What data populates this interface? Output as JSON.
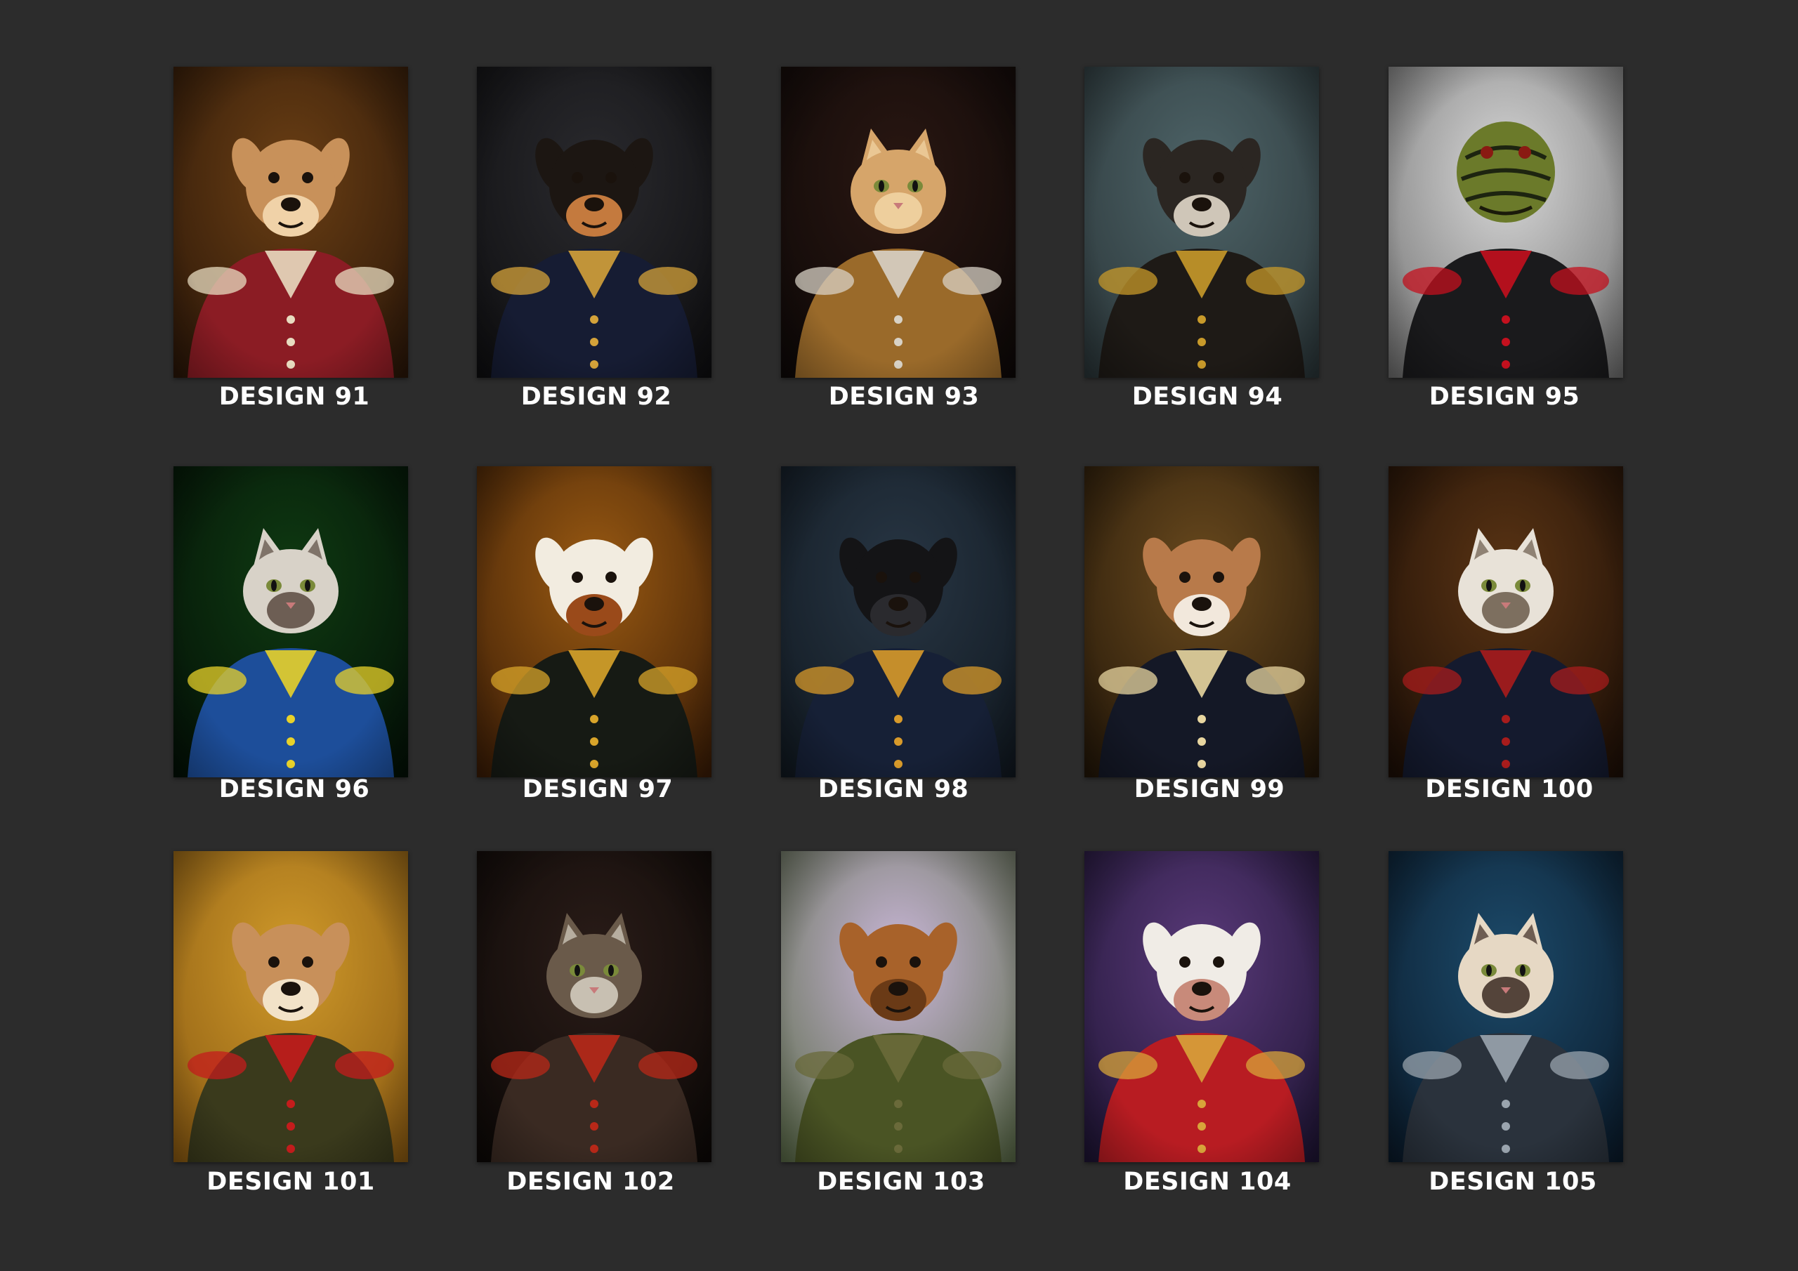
{
  "gallery": {
    "items": [
      {
        "label": "DESIGN 91",
        "subject": "bulldog-portrait",
        "bg": "#6b3f14",
        "bg2": "#2a1608",
        "fur": "#c8915a",
        "fur2": "#f0d2a8",
        "garment": "#8b1c24",
        "accent": "#e8dcc0",
        "icon": "dog-icon"
      },
      {
        "label": "DESIGN 92",
        "subject": "chihuahua-admiral",
        "bg": "#2a2a2e",
        "bg2": "#0e0e10",
        "fur": "#1c1612",
        "fur2": "#c47a3e",
        "garment": "#161c33",
        "accent": "#d4a23a",
        "icon": "dog-icon"
      },
      {
        "label": "DESIGN 93",
        "subject": "tabby-cat-ruff",
        "bg": "#2a1712",
        "bg2": "#0d0807",
        "fur": "#d6a56a",
        "fur2": "#f2d6a6",
        "garment": "#9a6a2a",
        "accent": "#d8d2c6",
        "icon": "cat-icon"
      },
      {
        "label": "DESIGN 94",
        "subject": "doodle-hussar",
        "bg": "#4e6468",
        "bg2": "#2a3538",
        "fur": "#2b2622",
        "fur2": "#cfc6b8",
        "garment": "#1e1a16",
        "accent": "#c89a2a",
        "icon": "dog-icon"
      },
      {
        "label": "DESIGN 95",
        "subject": "turtle-businessman",
        "bg": "#d8d8d8",
        "bg2": "#6f6f6f",
        "fur": "#6b7a2a",
        "fur2": "#1d2410",
        "garment": "#1a1a1c",
        "accent": "#c4101e",
        "icon": "turtle-icon"
      },
      {
        "label": "DESIGN 96",
        "subject": "cat-streetwear",
        "bg": "#0f3a12",
        "bg2": "#031006",
        "fur": "#d8d2c8",
        "fur2": "#5a4a40",
        "garment": "#1d4e9a",
        "accent": "#e8d22a",
        "icon": "cat-icon"
      },
      {
        "label": "DESIGN 97",
        "subject": "bulldog-general",
        "bg": "#9a5a12",
        "bg2": "#3a1c06",
        "fur": "#f2ece0",
        "fur2": "#9a4a1a",
        "garment": "#161a14",
        "accent": "#d8a42a",
        "icon": "dog-icon"
      },
      {
        "label": "DESIGN 98",
        "subject": "terrier-officer",
        "bg": "#283644",
        "bg2": "#101820",
        "fur": "#141416",
        "fur2": "#2a2a2e",
        "garment": "#162036",
        "accent": "#d89a2a",
        "icon": "dog-icon"
      },
      {
        "label": "DESIGN 99",
        "subject": "pitbull-gentleman",
        "bg": "#6a4a1e",
        "bg2": "#221608",
        "fur": "#b87a4a",
        "fur2": "#f2e8dc",
        "garment": "#141826",
        "accent": "#e8d6a0",
        "icon": "dog-icon"
      },
      {
        "label": "DESIGN 100",
        "subject": "cat-tuxedo-chair",
        "bg": "#5a3414",
        "bg2": "#1c0e06",
        "fur": "#e8e2d8",
        "fur2": "#6a5a4a",
        "garment": "#141a2e",
        "accent": "#a81c1c",
        "icon": "cat-icon"
      },
      {
        "label": "DESIGN 101",
        "subject": "collie-marshal",
        "bg": "#d09a2a",
        "bg2": "#8a5a12",
        "fur": "#c8905a",
        "fur2": "#f2e2c8",
        "garment": "#3a3a1c",
        "accent": "#c41c1c",
        "icon": "dog-icon"
      },
      {
        "label": "DESIGN 102",
        "subject": "tabby-lion-warrior",
        "bg": "#2a1c18",
        "bg2": "#0c0806",
        "fur": "#6a5a4a",
        "fur2": "#d8d2c4",
        "garment": "#3a2a22",
        "accent": "#b82818",
        "icon": "cat-icon"
      },
      {
        "label": "DESIGN 103",
        "subject": "doodle-countryman",
        "bg": "#c9b6d8",
        "bg2": "#5a6a48",
        "fur": "#a8622a",
        "fur2": "#6a3a16",
        "garment": "#4a5424",
        "accent": "#6a6a3a",
        "icon": "dog-icon"
      },
      {
        "label": "DESIGN 104",
        "subject": "bulldog-iron-armor",
        "bg": "#5a3a7a",
        "bg2": "#1e1434",
        "fur": "#f0ece6",
        "fur2": "#c88a7a",
        "garment": "#b81c22",
        "accent": "#d8a43a",
        "icon": "dog-icon"
      },
      {
        "label": "DESIGN 105",
        "subject": "siamese-cat-king",
        "bg": "#1c4a6a",
        "bg2": "#0a1a2a",
        "fur": "#e6d8c4",
        "fur2": "#3a2a22",
        "garment": "#2a323c",
        "accent": "#9aa4ae",
        "icon": "cat-icon"
      }
    ]
  }
}
